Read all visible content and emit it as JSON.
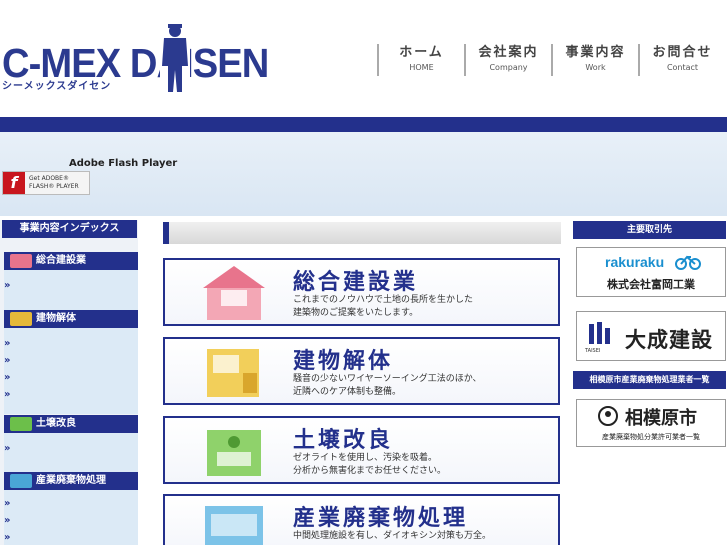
{
  "header": {
    "logo_main": "C-MEX DAISEN",
    "logo_sub": "シーメックスダイセン",
    "nav": [
      {
        "jp": "ホーム",
        "en": "HOME"
      },
      {
        "jp": "会社案内",
        "en": "Company"
      },
      {
        "jp": "事業内容",
        "en": "Work"
      },
      {
        "jp": "お問合せ",
        "en": "Contact"
      }
    ]
  },
  "flash": {
    "title": "Adobe Flash Player",
    "button_line1": "Get ADOBE®",
    "button_line2": "FLASH® PLAYER"
  },
  "sidebar": {
    "heading": "事業内容インデックス",
    "categories": [
      {
        "label": "総合建設業",
        "icon_label": "総合建設業",
        "color": "#e8748c"
      },
      {
        "label": "建物解体",
        "icon_label": "建物解体",
        "color": "#e5b93a"
      },
      {
        "label": "土壌改良",
        "icon_label": "土壌改良",
        "color": "#6cbf4a"
      },
      {
        "label": "産業廃棄物処理",
        "icon_label": "産業廃棄物処理",
        "color": "#4aa6d6"
      }
    ],
    "arrow": "»"
  },
  "main": {
    "cards": [
      {
        "title": "総合建設業",
        "desc": "これまでのノウハウで土地の長所を生かした\n建築物のご提案をいたします。",
        "icon_label": "総合\n建設業",
        "color": "#f3a7b5"
      },
      {
        "title": "建物解体",
        "desc": "騒音の少ないワイヤーソーイング工法のほか、\n近隣へのケア体制も整備。",
        "icon_label": "建物\n解体",
        "color": "#f2cf5a"
      },
      {
        "title": "土壌改良",
        "desc": "ゼオライトを使用し、汚染を吸着。\n分析から無害化までお任せください。",
        "icon_label": "土壌\n改良",
        "color": "#8fd26b"
      },
      {
        "title": "産業廃棄物処理",
        "desc": "中間処理施設を有し、ダイオキシン対策も万全。",
        "icon_label": "産業廃棄物\n処理",
        "color": "#7cc3e8"
      }
    ]
  },
  "right": {
    "heading": "主要取引先",
    "partners": [
      {
        "brand": "rakuraku",
        "name": "株式会社富岡工業",
        "brand_color": "#1a8fcf"
      },
      {
        "brand": "TAISEI",
        "name": "大成建設"
      }
    ],
    "heading2": "相模原市産業廃棄物処理業者一覧",
    "city": {
      "name": "相模原市",
      "sub": "産業廃棄物処分業許可業者一覧"
    }
  },
  "colors": {
    "brand": "#23308c"
  }
}
